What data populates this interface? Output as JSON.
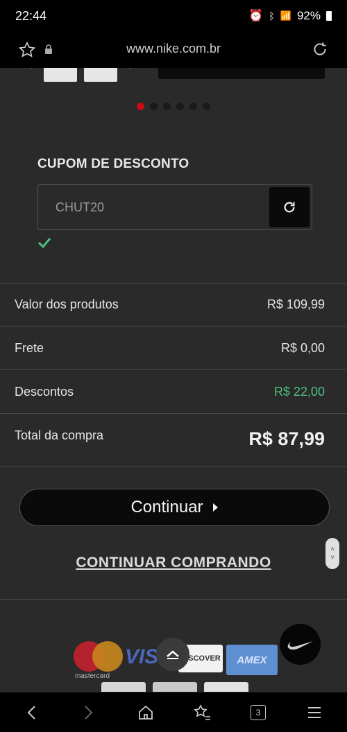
{
  "status_bar": {
    "time": "22:44",
    "battery": "92%"
  },
  "browser": {
    "url": "www.nike.com.br"
  },
  "coupon": {
    "title": "CUPOM DE DESCONTO",
    "code": "CHUT20"
  },
  "summary": [
    {
      "label": "Valor dos produtos",
      "value": "R$ 109,99"
    },
    {
      "label": "Frete",
      "value": "R$ 0,00"
    },
    {
      "label": "Descontos",
      "value": "R$ 22,00"
    },
    {
      "label": "Total da compra",
      "value": "R$ 87,99"
    }
  ],
  "actions": {
    "continue": "Continuar",
    "continue_shopping": "CONTINUAR COMPRANDO"
  },
  "carousel": {
    "slides": 6,
    "active": 1
  },
  "payment": {
    "mastercard": "mastercard",
    "visa": "VISA",
    "discover": "DISCOVER",
    "amex": "AMEX"
  },
  "tabs": {
    "count": "3"
  },
  "colors": {
    "accent_red": "#cc0b14",
    "discount_green": "#4fbf7f",
    "background": "#2a2a2a"
  }
}
